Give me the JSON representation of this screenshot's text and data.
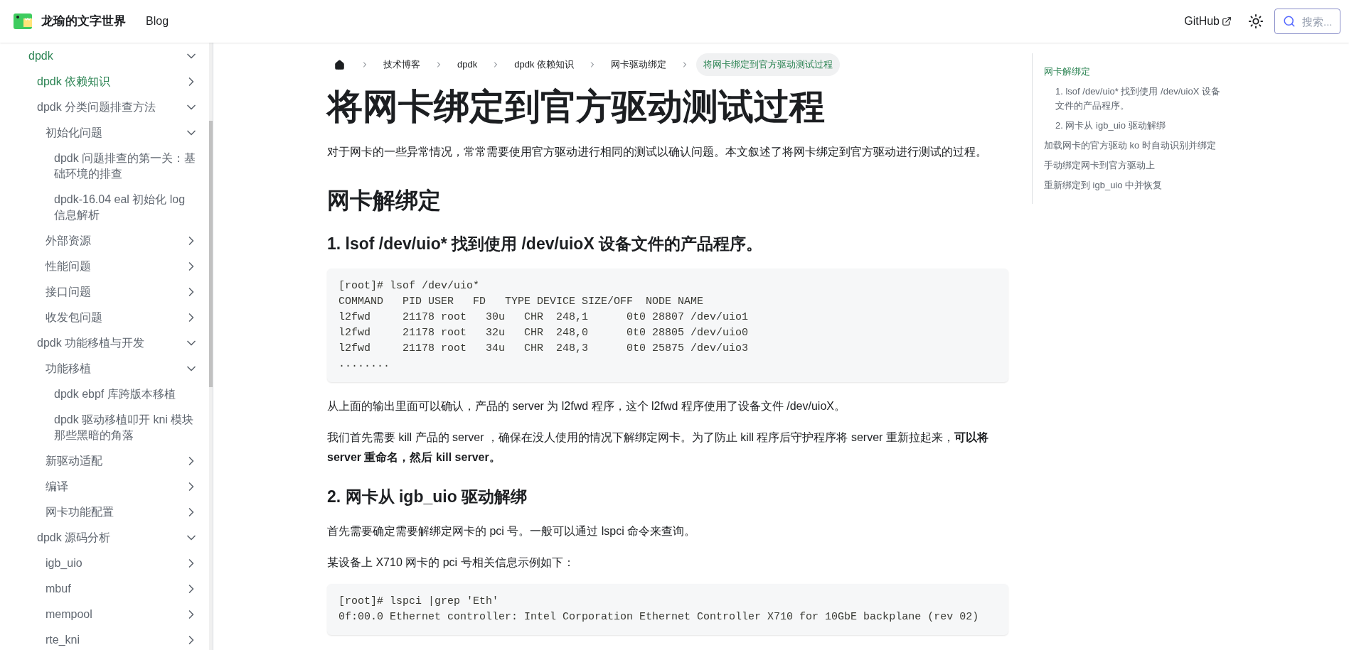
{
  "navbar": {
    "title": "龙瑜的文字世界",
    "links": [
      {
        "label": "Blog",
        "kind": "internal"
      },
      {
        "label": "GitHub",
        "kind": "external"
      }
    ],
    "search": {
      "placeholder": "搜索..."
    }
  },
  "sidebar": {
    "items": [
      {
        "label": "dpdk",
        "kind": "category",
        "expanded": true,
        "active": true,
        "children": [
          {
            "label": "dpdk 依赖知识",
            "kind": "category",
            "expanded": false,
            "active": true
          },
          {
            "label": "dpdk 分类问题排查方法",
            "kind": "category",
            "expanded": true,
            "active": false,
            "children": [
              {
                "label": "初始化问题",
                "kind": "category",
                "expanded": true,
                "active": false,
                "children": [
                  {
                    "label": "dpdk 问题排查的第一关：基础环境的排查",
                    "kind": "link",
                    "active": false
                  },
                  {
                    "label": "dpdk-16.04 eal 初始化 log 信息解析",
                    "kind": "link",
                    "active": false
                  }
                ]
              },
              {
                "label": "外部资源",
                "kind": "category",
                "expanded": false,
                "active": false
              },
              {
                "label": "性能问题",
                "kind": "category",
                "expanded": false,
                "active": false
              },
              {
                "label": "接口问题",
                "kind": "category",
                "expanded": false,
                "active": false
              },
              {
                "label": "收发包问题",
                "kind": "category",
                "expanded": false,
                "active": false
              }
            ]
          },
          {
            "label": "dpdk 功能移植与开发",
            "kind": "category",
            "expanded": true,
            "active": false,
            "children": [
              {
                "label": "功能移植",
                "kind": "category",
                "expanded": true,
                "active": false,
                "children": [
                  {
                    "label": "dpdk ebpf 库跨版本移植",
                    "kind": "link",
                    "active": false
                  },
                  {
                    "label": "dpdk 驱动移植叩开 kni 模块那些黑暗的角落",
                    "kind": "link",
                    "active": false
                  }
                ]
              },
              {
                "label": "新驱动适配",
                "kind": "category",
                "expanded": false,
                "active": false
              },
              {
                "label": "编译",
                "kind": "category",
                "expanded": false,
                "active": false
              },
              {
                "label": "网卡功能配置",
                "kind": "category",
                "expanded": false,
                "active": false
              }
            ]
          },
          {
            "label": "dpdk 源码分析",
            "kind": "category",
            "expanded": true,
            "active": false,
            "children": [
              {
                "label": "igb_uio",
                "kind": "category",
                "expanded": false,
                "active": false
              },
              {
                "label": "mbuf",
                "kind": "category",
                "expanded": false,
                "active": false
              },
              {
                "label": "mempool",
                "kind": "category",
                "expanded": false,
                "active": false
              },
              {
                "label": "rte_kni",
                "kind": "category",
                "expanded": false,
                "active": false
              }
            ]
          }
        ]
      }
    ]
  },
  "breadcrumbs": [
    {
      "label": "技术博客",
      "selected": false
    },
    {
      "label": "dpdk",
      "selected": false
    },
    {
      "label": "dpdk 依赖知识",
      "selected": false
    },
    {
      "label": "网卡驱动绑定",
      "selected": false
    },
    {
      "label": "将网卡绑定到官方驱动测试过程",
      "selected": true
    }
  ],
  "article": {
    "title": "将网卡绑定到官方驱动测试过程",
    "blocks": [
      {
        "kind": "p",
        "text": "对于网卡的一些异常情况，常常需要使用官方驱动进行相同的测试以确认问题。本文叙述了将网卡绑定到官方驱动进行测试的过程。"
      },
      {
        "kind": "h2",
        "text": "网卡解绑定"
      },
      {
        "kind": "h3",
        "text": "1. lsof /dev/uio* 找到使用 /dev/uioX 设备文件的产品程序。"
      },
      {
        "kind": "code",
        "lines": [
          "[root]# lsof /dev/uio*",
          "COMMAND   PID USER   FD   TYPE DEVICE SIZE/OFF  NODE NAME",
          "l2fwd     21178 root   30u   CHR  248,1      0t0 28807 /dev/uio1",
          "l2fwd     21178 root   32u   CHR  248,0      0t0 28805 /dev/uio0",
          "l2fwd     21178 root   34u   CHR  248,3      0t0 25875 /dev/uio3",
          "........"
        ]
      },
      {
        "kind": "p",
        "text": "从上面的输出里面可以确认，产品的 server 为 l2fwd 程序，这个 l2fwd 程序使用了设备文件 /dev/uioX。"
      },
      {
        "kind": "p",
        "text": "我们首先需要 kill 产品的 server ，确保在没人使用的情况下解绑定网卡。为了防止 kill 程序后守护程序将 server 重新拉起来，**可以将 server 重命名，然后 kill server。**"
      },
      {
        "kind": "h3",
        "text": "2. 网卡从 igb_uio 驱动解绑"
      },
      {
        "kind": "p",
        "text": "首先需要确定需要解绑定网卡的 pci 号。一般可以通过 lspci 命令来查询。"
      },
      {
        "kind": "p",
        "text": "某设备上 X710 网卡的 pci 号相关信息示例如下："
      },
      {
        "kind": "code",
        "lines": [
          "[root]# lspci |grep 'Eth'",
          "0f:00.0 Ethernet controller: Intel Corporation Ethernet Controller X710 for 10GbE backplane (rev 02)"
        ]
      }
    ]
  },
  "toc": [
    {
      "label": "网卡解绑定",
      "active": true,
      "children": [
        {
          "label": "1. lsof /dev/uio* 找到使用 /dev/uioX 设备文件的产品程序。",
          "active": false
        },
        {
          "label": "2. 网卡从 igb_uio 驱动解绑",
          "active": false
        }
      ]
    },
    {
      "label": "加载网卡的官方驱动 ko 时自动识别并绑定",
      "active": false
    },
    {
      "label": "手动绑定网卡到官方驱动上",
      "active": false
    },
    {
      "label": "重新绑定到 igb_uio 中并恢复",
      "active": false
    }
  ]
}
